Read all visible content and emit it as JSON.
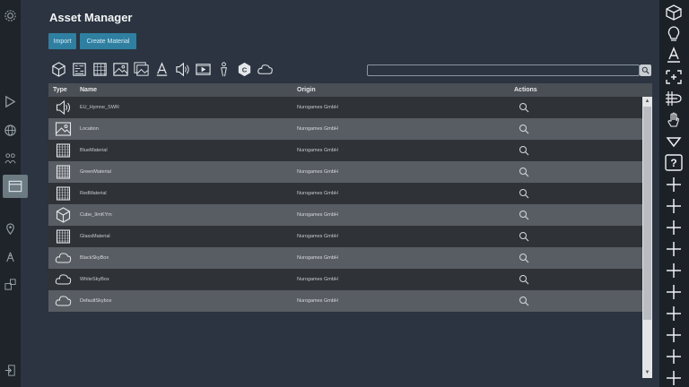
{
  "header": {
    "title": "Asset Manager"
  },
  "buttons": {
    "import": "Import",
    "create_material": "Create Material"
  },
  "type_filters": [
    "cube-icon",
    "material-pattern-icon",
    "texture-icon",
    "image-icon",
    "images-icon",
    "text-icon",
    "audio-icon",
    "video-icon",
    "person-icon",
    "code-icon",
    "skybox-icon"
  ],
  "search": {
    "placeholder": ""
  },
  "table": {
    "headers": {
      "type": "Type",
      "name": "Name",
      "origin": "Origin",
      "actions": "Actions"
    },
    "rows": [
      {
        "icon": "audio-icon",
        "name": "EU_Hymne_SWR",
        "origin": "Nurogames GmbH"
      },
      {
        "icon": "image-icon",
        "name": "Location",
        "origin": "Nurogames GmbH"
      },
      {
        "icon": "material-icon",
        "name": "BlueMaterial",
        "origin": "Nurogames GmbH"
      },
      {
        "icon": "material-icon",
        "name": "GreenMaterial",
        "origin": "Nurogames GmbH"
      },
      {
        "icon": "material-icon",
        "name": "RedMaterial",
        "origin": "Nurogames GmbH"
      },
      {
        "icon": "cube-icon",
        "name": "Cube_9mKYm",
        "origin": "Nurogames GmbH"
      },
      {
        "icon": "material-icon",
        "name": "GlassMaterial",
        "origin": "Nurogames GmbH"
      },
      {
        "icon": "cloud-icon",
        "name": "BlackSkyBox",
        "origin": "Nurogames GmbH"
      },
      {
        "icon": "cloud-icon",
        "name": "WhiteSkyBox",
        "origin": "Nurogames GmbH"
      },
      {
        "icon": "cloud-icon",
        "name": "DefaultSkybox",
        "origin": "Nurogames GmbH"
      }
    ]
  },
  "left_rail": [
    "gear-icon",
    "play-icon",
    "globe-icon",
    "people-icon",
    "assets-icon",
    "location-pin-icon",
    "antenna-icon",
    "puzzle-icon",
    "exit-icon"
  ],
  "right_rail": [
    "cube-icon",
    "lightbulb-icon",
    "text-icon",
    "select-icon",
    "grid-snap-icon",
    "hand-icon",
    "triangle-down-icon",
    "help-icon",
    "plus-icon",
    "plus-icon",
    "plus-icon",
    "plus-icon",
    "plus-icon",
    "plus-icon",
    "plus-icon",
    "plus-icon",
    "plus-icon",
    "plus-icon"
  ],
  "colors": {
    "background": "#2b3440",
    "accent": "#2f7fa1",
    "row_dark": "#2f3338",
    "row_light": "#585d63"
  }
}
